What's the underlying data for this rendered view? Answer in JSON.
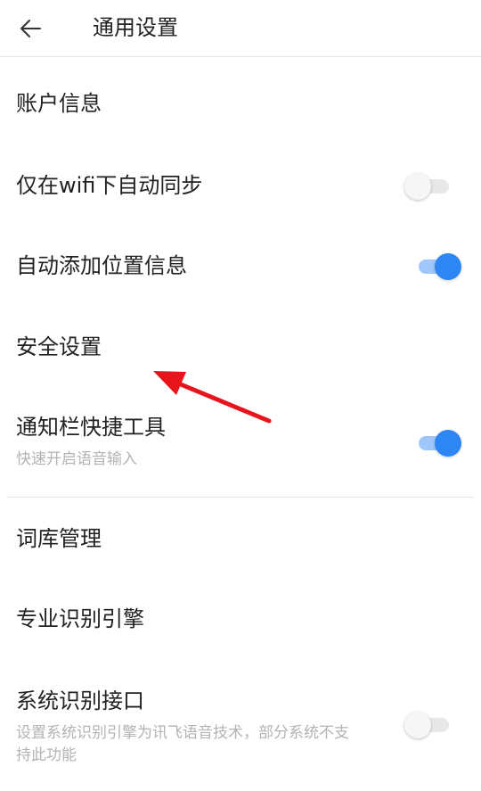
{
  "header": {
    "back_icon": "arrow-left-icon",
    "title": "通用设置"
  },
  "settings": {
    "account": {
      "title": "账户信息"
    },
    "wifi_sync": {
      "title": "仅在wifi下自动同步",
      "toggle_on": false
    },
    "location": {
      "title": "自动添加位置信息",
      "toggle_on": true
    },
    "security": {
      "title": "安全设置"
    },
    "notification": {
      "title": "通知栏快捷工具",
      "subtitle": "快速开启语音输入",
      "toggle_on": true
    },
    "lexicon": {
      "title": "词库管理"
    },
    "engine": {
      "title": "专业识别引擎"
    },
    "system": {
      "title": "系统识别接口",
      "subtitle": "设置系统识别引擎为讯飞语音技术，部分系统不支持此功能",
      "toggle_on": false
    }
  },
  "colors": {
    "accent": "#2d86f3",
    "accent_track": "#9fc7fb",
    "annotation_arrow": "#e8141b",
    "subtitle": "#b3b3b3"
  },
  "annotation": {
    "icon": "red-pointer-arrow"
  }
}
